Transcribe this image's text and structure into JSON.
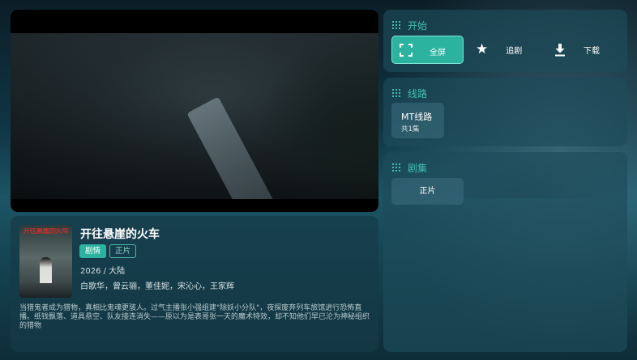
{
  "video": {
    "state": "playing"
  },
  "movie": {
    "poster_title": "开往悬崖的火车",
    "title": "开往悬崖的火车",
    "tags": [
      "剧情",
      "正片"
    ],
    "year_region": "2026 / 大陆",
    "cast": "白歌华，曾云骊，董佳妮，宋沁心，王家辉",
    "description": "当猎鬼者成为猎物，真相比鬼魂更骇人。过气主播张小强组建\"除妖小分队\"，夜探废弃列车旅馆进行恐怖直播。纸钱飘落、道具悬空、队友接连消失——原以为是表哥张一天的魔术特效，却不知他们早已沦为神秘组织的猎物"
  },
  "start_section": {
    "title": "开始",
    "fullscreen_label": "全屏",
    "follow_label": "追剧",
    "download_label": "下载"
  },
  "route_section": {
    "title": "线路",
    "routes": [
      {
        "name": "MT线路",
        "count": "共1集"
      }
    ]
  },
  "episodes_section": {
    "title": "剧集",
    "episodes": [
      "正片"
    ]
  },
  "colors": {
    "accent": "#2cb3a0",
    "accent_text": "#3fc0ad",
    "card_bg": "#1e4b5a"
  },
  "icons": {
    "section": "grid-icon",
    "fullscreen": "fullscreen-icon",
    "follow": "star-icon",
    "download": "download-icon"
  }
}
